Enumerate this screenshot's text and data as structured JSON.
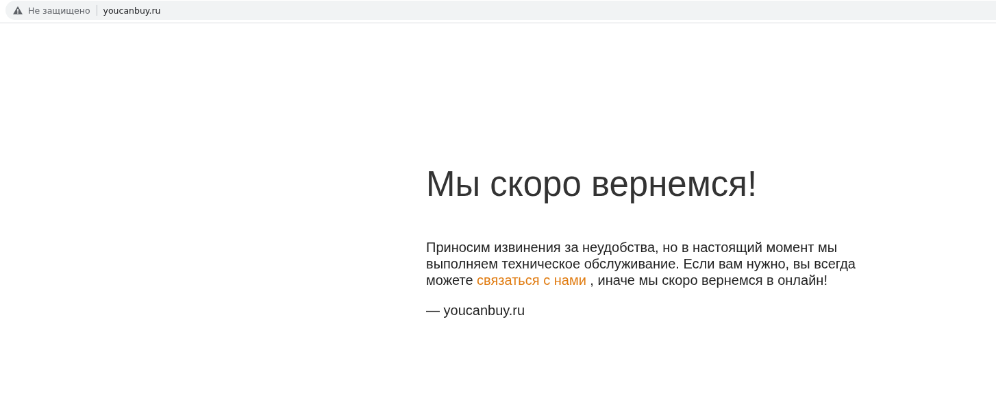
{
  "address_bar": {
    "security_label": "Не защищено",
    "url": "youcanbuy.ru"
  },
  "page": {
    "heading": "Мы скоро вернемся!",
    "message": {
      "before": "Приносим извинения за неудобства, но в настоящий момент мы выполняем техническое обслуживание. Если вам нужно, вы всегда можете ",
      "link": "связаться с нами",
      "after": " , иначе мы скоро вернемся в онлайн!"
    },
    "signature": "— youcanbuy.ru"
  }
}
